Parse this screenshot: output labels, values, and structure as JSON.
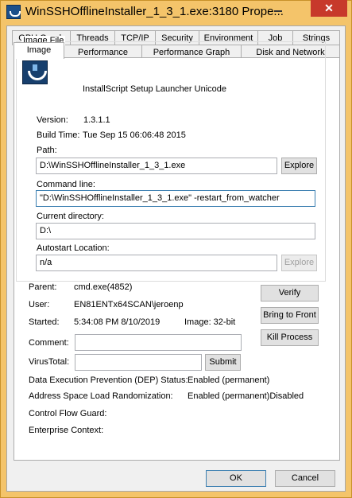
{
  "window": {
    "title": "WinSSHOfflineInstaller_1_3_1.exe:3180 Prope...",
    "minimize_icon": "minimize-icon",
    "close_glyph": "✕"
  },
  "tabs_row1": [
    "GPU Graph",
    "Threads",
    "TCP/IP",
    "Security",
    "Environment",
    "Job",
    "Strings"
  ],
  "tabs_row2": [
    "Image",
    "Performance",
    "Performance Graph",
    "Disk and Network"
  ],
  "active_tab": "Image",
  "image_file": {
    "legend": "Image File",
    "description": "InstallScript Setup Launcher Unicode",
    "version_label": "Version:",
    "version_value": "1.3.1.1",
    "build_label": "Build Time:",
    "build_value": "Tue Sep 15 06:06:48 2015",
    "path_label": "Path:",
    "path_value": "D:\\WinSSHOfflineInstaller_1_3_1.exe",
    "explore_label": "Explore",
    "cmdline_label": "Command line:",
    "cmdline_value": "\"D:\\WinSSHOfflineInstaller_1_3_1.exe\"  -restart_from_watcher",
    "curdir_label": "Current directory:",
    "curdir_value": "D:\\",
    "autostart_label": "Autostart Location:",
    "autostart_value": "n/a",
    "autostart_explore_label": "Explore"
  },
  "process": {
    "parent_label": "Parent:",
    "parent_value": "cmd.exe(4852)",
    "user_label": "User:",
    "user_value": "EN81ENTx64SCAN\\jeroenp",
    "started_label": "Started:",
    "started_value": "5:34:08 PM  8/10/2019",
    "image_bits": "Image: 32-bit",
    "comment_label": "Comment:",
    "comment_value": "",
    "virustotal_label": "VirusTotal:",
    "virustotal_value": "",
    "submit_label": "Submit",
    "verify_label": "Verify",
    "bring_front_label": "Bring to Front",
    "kill_label": "Kill Process",
    "dep_label": "Data Execution Prevention (DEP) Status:",
    "dep_value": "Enabled (permanent)",
    "aslr_label": "Address Space Load Randomization:",
    "aslr_value": "Enabled (permanent)Disabled",
    "cfg_label": "Control Flow Guard:",
    "enterprise_label": "Enterprise Context:"
  },
  "footer": {
    "ok_label": "OK",
    "cancel_label": "Cancel"
  },
  "colors": {
    "title_bar": "#f4c46a",
    "close_button": "#c7392b",
    "dialog_bg": "#f0f0f0",
    "panel_bg": "#ffffff"
  }
}
